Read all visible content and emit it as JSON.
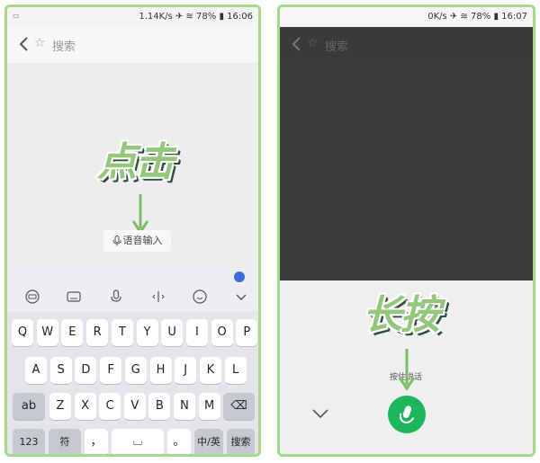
{
  "left": {
    "status": {
      "speed": "1.14K/s",
      "battery": "78%",
      "time": "16:06"
    },
    "search": {
      "placeholder": "搜索"
    },
    "overlay_text": "点击",
    "voice_button": "语音输入",
    "keyboard": {
      "row1": [
        "Q",
        "W",
        "E",
        "R",
        "T",
        "Y",
        "U",
        "I",
        "O",
        "P"
      ],
      "row2": [
        "A",
        "S",
        "D",
        "F",
        "G",
        "H",
        "J",
        "K",
        "L"
      ],
      "row3": [
        "Z",
        "X",
        "C",
        "V",
        "B",
        "N",
        "M"
      ],
      "shift": "ab",
      "num": "123",
      "symbol": "符",
      "comma": "，",
      "period": "。",
      "lang": "中/英",
      "search": "搜索"
    },
    "toolbar_icons": [
      "emoji-face-icon",
      "keyboard-icon",
      "microphone-icon",
      "cursor-icon",
      "smiley-icon",
      "chevron-down-icon"
    ]
  },
  "right": {
    "status": {
      "speed": "0K/s",
      "battery": "78%",
      "time": "16:07"
    },
    "search": {
      "placeholder": "搜索"
    },
    "overlay_text": "长按",
    "hold_text": "按住说话"
  },
  "colors": {
    "accent_green": "#1db65b",
    "arrow_green": "#7dbb6a",
    "frame": "#a8d98a"
  }
}
